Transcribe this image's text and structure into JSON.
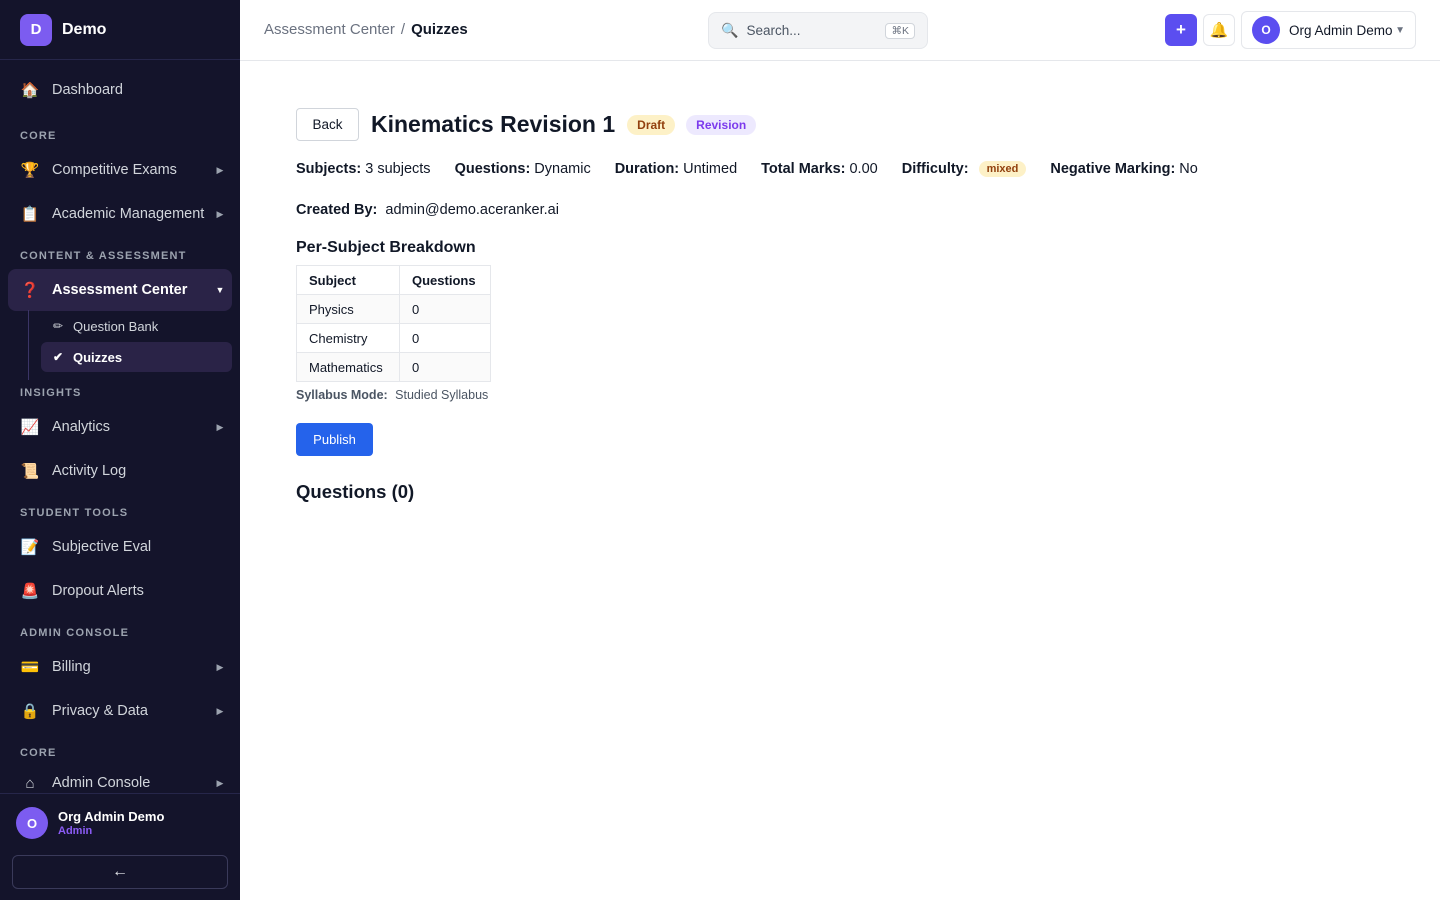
{
  "sidebar": {
    "brand_initial": "D",
    "brand_name": "Demo",
    "sections": {
      "core": "CORE",
      "content": "CONTENT & ASSESSMENT",
      "insights": "INSIGHTS",
      "student_tools": "STUDENT TOOLS",
      "admin_console": "ADMIN CONSOLE",
      "core2": "CORE"
    },
    "items": {
      "dashboard": {
        "label": "Dashboard",
        "icon": "house-icon"
      },
      "competitive_exams": {
        "label": "Competitive Exams",
        "icon": "trophy-icon"
      },
      "academic_management": {
        "label": "Academic Management",
        "icon": "clipboard-icon"
      },
      "assessment_center": {
        "label": "Assessment Center",
        "icon": "question-mark-icon"
      },
      "analytics": {
        "label": "Analytics",
        "icon": "chart-increasing-icon"
      },
      "activity_log": {
        "label": "Activity Log",
        "icon": "scroll-icon"
      },
      "subjective_eval": {
        "label": "Subjective Eval",
        "icon": "memo-icon"
      },
      "dropout_alerts": {
        "label": "Dropout Alerts",
        "icon": "siren-icon"
      },
      "billing": {
        "label": "Billing",
        "icon": "credit-card-icon"
      },
      "privacy_data": {
        "label": "Privacy & Data",
        "icon": "lock-icon"
      },
      "admin_console": {
        "label": "Admin Console",
        "icon": "home-outline-icon"
      }
    },
    "subitems": {
      "question_bank": {
        "label": "Question Bank",
        "icon": "pencil-icon"
      },
      "quizzes": {
        "label": "Quizzes",
        "icon": "check-icon"
      }
    },
    "user": {
      "initial": "O",
      "name": "Org Admin Demo",
      "role": "Admin"
    },
    "collapse_label": "←"
  },
  "topbar": {
    "breadcrumb": [
      "Assessment Center",
      "Quizzes"
    ],
    "breadcrumb_sep": "/",
    "search_placeholder": "Search...",
    "search_shortcut": "⌘K",
    "add_label": "+",
    "account": {
      "initial": "O",
      "name": "Org Admin Demo"
    }
  },
  "quiz": {
    "back_label": "Back",
    "title": "Kinematics Revision 1",
    "status_badge": "Draft",
    "type_badge": "Revision",
    "meta": {
      "subjects_label": "Subjects:",
      "subjects_value": "3 subjects",
      "questions_label": "Questions:",
      "questions_value": "Dynamic",
      "duration_label": "Duration:",
      "duration_value": "Untimed",
      "total_marks_label": "Total Marks:",
      "total_marks_value": "0.00",
      "difficulty_label": "Difficulty:",
      "difficulty_value": "mixed",
      "negative_label": "Negative Marking:",
      "negative_value": "No"
    },
    "created_by_label": "Created By:",
    "created_by_value": "admin@demo.aceranker.ai",
    "breakdown_title": "Per-Subject Breakdown",
    "breakdown_headers": [
      "Subject",
      "Questions"
    ],
    "breakdown_rows": [
      [
        "Physics",
        "0"
      ],
      [
        "Chemistry",
        "0"
      ],
      [
        "Mathematics",
        "0"
      ]
    ],
    "syllabus_label": "Syllabus Mode:",
    "syllabus_value": "Studied Syllabus",
    "publish_label": "Publish",
    "questions_heading": "Questions (0)"
  },
  "colors": {
    "sidebar_bg": "#14142b",
    "accent": "#5b4ef0",
    "brand_purple": "#7c5cf0",
    "publish_blue": "#2563eb",
    "draft_badge_bg": "#fdf1c7",
    "revision_badge_bg": "#ede9fe"
  }
}
